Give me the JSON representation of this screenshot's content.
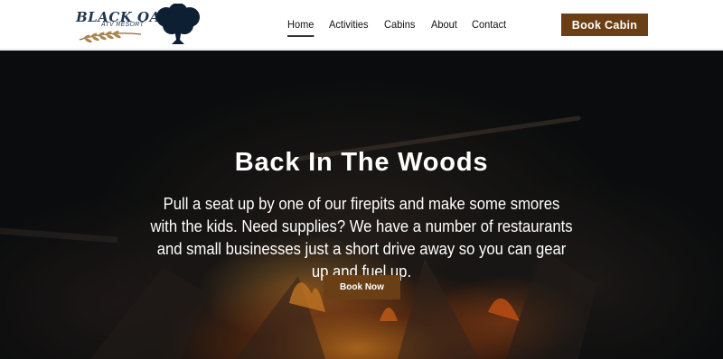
{
  "header": {
    "logo": {
      "line1": "BLACK OAK",
      "line2": "ATV RESORT"
    },
    "nav": [
      {
        "label": "Home",
        "active": true
      },
      {
        "label": "Activities",
        "active": false
      },
      {
        "label": "Cabins",
        "active": false
      },
      {
        "label": "About",
        "active": false
      },
      {
        "label": "Contact",
        "active": false
      }
    ],
    "cta_label": "Book Cabin"
  },
  "hero": {
    "title": "Back In The Woods",
    "body": "Pull a seat up by one of our firepits and make some smores with the kids. Need supplies? We have a number of restaurants and small businesses just a short drive away so you can gear up and fuel up.",
    "button_label": "Book Now",
    "background_image": "campfire-photo"
  },
  "colors": {
    "brand_brown": "#6b3f15",
    "logo_navy": "#1e3650",
    "hero_text": "#ffffff"
  },
  "icons": [
    "oak-tree-icon",
    "wheat-icon"
  ]
}
